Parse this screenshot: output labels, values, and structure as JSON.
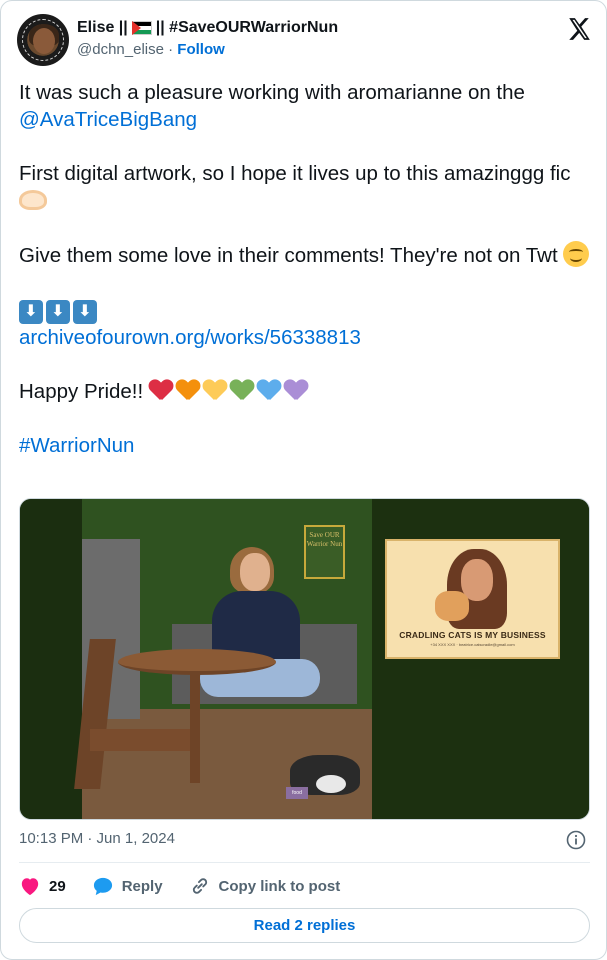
{
  "author": {
    "name_part1": "Elise ||",
    "name_part2": "|| #SaveOURWarriorNun",
    "handle": "@dchn_elise",
    "separator": "·",
    "follow_label": "Follow",
    "avatar_ring_text": "WARRIOR NUN · THAT SAVED US"
  },
  "tweet": {
    "line1": "It was such a pleasure working with aromarianne on the",
    "mention": "@AvaTriceBigBang",
    "line2": "First digital artwork, so I hope it lives up to this amazinggg fic",
    "line3": "Give them some love in their comments! They're not on Twt",
    "arrows": [
      "⬇",
      "⬇",
      "⬇"
    ],
    "ao3_link": "archiveofourown.org/works/56338813",
    "pride": "Happy Pride!!",
    "hearts": [
      "#dd2e44",
      "#f4900c",
      "#fdcb58",
      "#78b159",
      "#5dadec",
      "#aa8ed6"
    ],
    "hashtag": "#WarriorNun"
  },
  "artwork": {
    "small_poster": "Save OUR Warrior Nun",
    "big_poster_caption": "CRADLING CATS IS MY BUSINESS",
    "big_poster_sub": "+34 XXX XXX · beatrice.catscradle@gmail.com",
    "bowl_label": "food"
  },
  "meta": {
    "timestamp": "10:13 PM · Jun 1, 2024"
  },
  "actions": {
    "like_count": "29",
    "reply_label": "Reply",
    "copy_label": "Copy link to post",
    "read_replies_label": "Read 2 replies"
  },
  "colors": {
    "link": "#006fd6",
    "like": "#f91880",
    "muted": "#536471"
  },
  "icons": [
    "x-logo-icon",
    "info-icon",
    "heart-icon",
    "reply-bubble-icon",
    "link-icon"
  ]
}
